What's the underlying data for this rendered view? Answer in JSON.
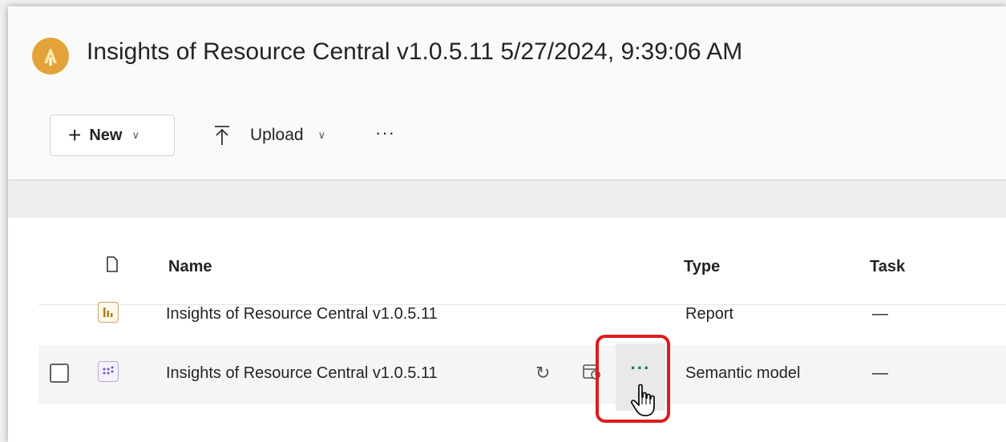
{
  "header": {
    "title": "Insights of Resource Central v1.0.5.11 5/27/2024, 9:39:06 AM",
    "logo_icon": "workspace-logo-icon"
  },
  "toolbar": {
    "new_label": "New",
    "upload_label": "Upload",
    "more_label": "···"
  },
  "table": {
    "columns": {
      "icon": "file-icon",
      "name": "Name",
      "type": "Type",
      "task": "Task"
    },
    "rows": [
      {
        "name": "Insights of Resource Central v1.0.5.11",
        "type": "Report",
        "task": "—",
        "icon": "report-icon"
      },
      {
        "name": "Insights of Resource Central v1.0.5.11",
        "type": "Semantic model",
        "task": "—",
        "icon": "semantic-model-icon",
        "more_label": "···"
      }
    ]
  },
  "colors": {
    "accent_logo": "#e3a33a",
    "highlight": "#e01b1b",
    "more_dots": "#127a3c"
  }
}
